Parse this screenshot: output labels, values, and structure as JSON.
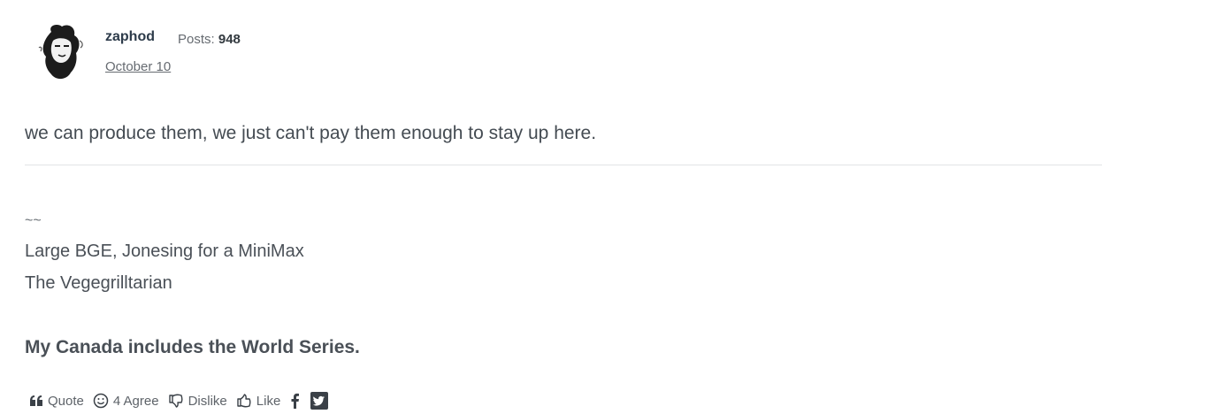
{
  "post": {
    "author": "zaphod",
    "posts_label": "Posts:",
    "posts_count": "948",
    "date": "October 10",
    "avatar_icon": "sketch-portrait-avatar",
    "message": "we can produce them, we just can't pay them enough to stay up here."
  },
  "signature": {
    "line1": "~~",
    "line2": "Large BGE, Jonesing for a MiniMax",
    "line3": "The Vegegrilltarian",
    "bold": "My Canada includes the World Series."
  },
  "reactions": {
    "quote": "Quote",
    "agree": "4 Agree",
    "dislike": "Dislike",
    "like": "Like",
    "share_icons": [
      "facebook-icon",
      "twitter-icon"
    ]
  },
  "colors": {
    "text": "#444b52",
    "author": "#2d3b4a",
    "divider": "#e2e4e6",
    "icon": "#3a4047"
  }
}
